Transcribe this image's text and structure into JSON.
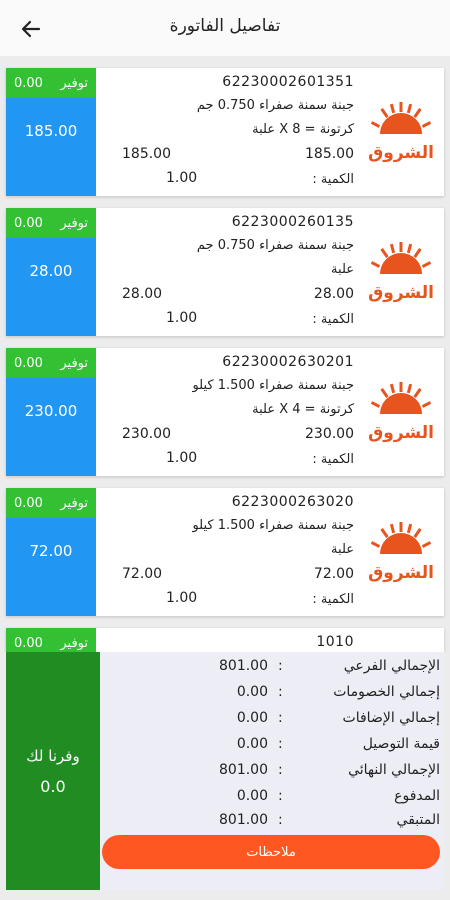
{
  "header": {
    "title": "تفاصيل الفاتورة",
    "back_icon": "arrow-left-icon"
  },
  "brand": {
    "logo_text": "الشروق",
    "logo_color": "#e8541e"
  },
  "colors": {
    "savings_green": "#33c033",
    "price_blue": "#2196f3",
    "saved_box_green": "#218c21",
    "notes_orange": "#ff5722"
  },
  "items": [
    {
      "barcode": "6223000260135",
      "name": "جبنة سمنة صفراء 0.750 جم",
      "pack": "علبة",
      "price_left": "28.00",
      "price_right": "28.00",
      "qty_label": "الكمية :",
      "qty": "1.00",
      "savings_label": "توفير",
      "savings": "0.00",
      "price": "28.00"
    },
    {
      "barcode": "62230002630201",
      "name": "جبنة سمنة صفراء 1.500 كيلو",
      "pack": "كرتونة = 4 X علبة",
      "price_left": "230.00",
      "price_right": "230.00",
      "qty_label": "الكمية :",
      "qty": "1.00",
      "savings_label": "توفير",
      "savings": "0.00",
      "price": "230.00"
    },
    {
      "barcode": "6223000263020",
      "name": "جبنة سمنة صفراء 1.500 كيلو",
      "pack": "علبة",
      "price_left": "72.00",
      "price_right": "72.00",
      "qty_label": "الكمية :",
      "qty": "1.00",
      "savings_label": "توفير",
      "savings": "0.00",
      "price": "72.00"
    }
  ],
  "first_item": {
    "barcode": "62230002601351",
    "name": "جبنة سمنة صفراء 0.750 جم",
    "pack": "كرتونة = 8 X علبة",
    "price_left": "185.00",
    "price_right": "185.00",
    "qty_label": "الكمية :",
    "qty": "1.00",
    "savings_label": "توفير",
    "savings": "0.00",
    "price": "185.00"
  },
  "partial_item": {
    "barcode": "1010",
    "savings_label": "توفير",
    "savings": "0.00"
  },
  "summary": {
    "saved_title": "وفرنا لك",
    "saved_value": "0.0",
    "rows": [
      {
        "label": "الإجمالي الفرعي",
        "colon": ":",
        "value": "801.00"
      },
      {
        "label": "إجمالي الخصومات",
        "colon": ":",
        "value": "0.00"
      },
      {
        "label": "إجمالي الإضافات",
        "colon": ":",
        "value": "0.00"
      },
      {
        "label": "قيمة التوصيل",
        "colon": ":",
        "value": "0.00"
      },
      {
        "label": "الإجمالي النهائي",
        "colon": ":",
        "value": "801.00"
      },
      {
        "label": "المدفوع",
        "colon": ":",
        "value": "0.00"
      },
      {
        "label": "المتبقي",
        "colon": ":",
        "value": "801.00"
      }
    ],
    "notes_label": "ملاحظات"
  }
}
